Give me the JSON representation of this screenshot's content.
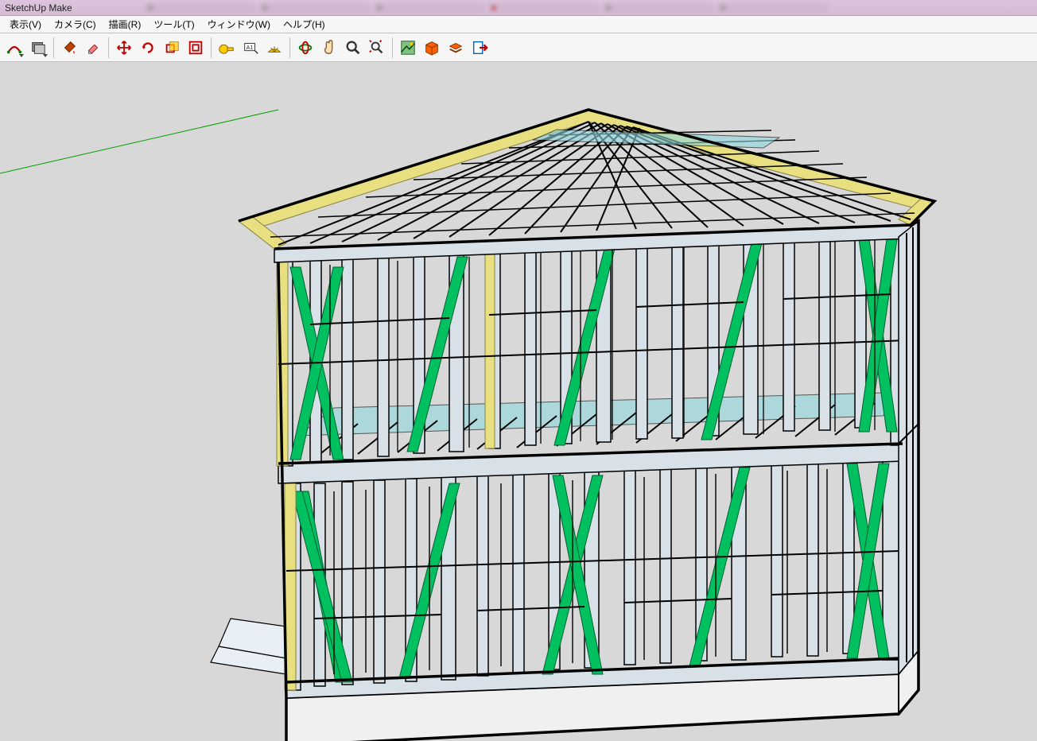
{
  "app": {
    "title": "SketchUp Make"
  },
  "menu": {
    "view": "表示(V)",
    "camera": "カメラ(C)",
    "draw": "描画(R)",
    "tools": "ツール(T)",
    "window": "ウィンドウ(W)",
    "help": "ヘルプ(H)"
  },
  "toolbar": {
    "icons": [
      "arc",
      "rectangle",
      "paint-bucket",
      "eraser",
      "move",
      "rotate",
      "scale",
      "offset",
      "tape-measure",
      "text",
      "dimension",
      "orbit",
      "pan",
      "zoom",
      "zoom-extents",
      "walk",
      "section",
      "layers",
      "export"
    ]
  }
}
